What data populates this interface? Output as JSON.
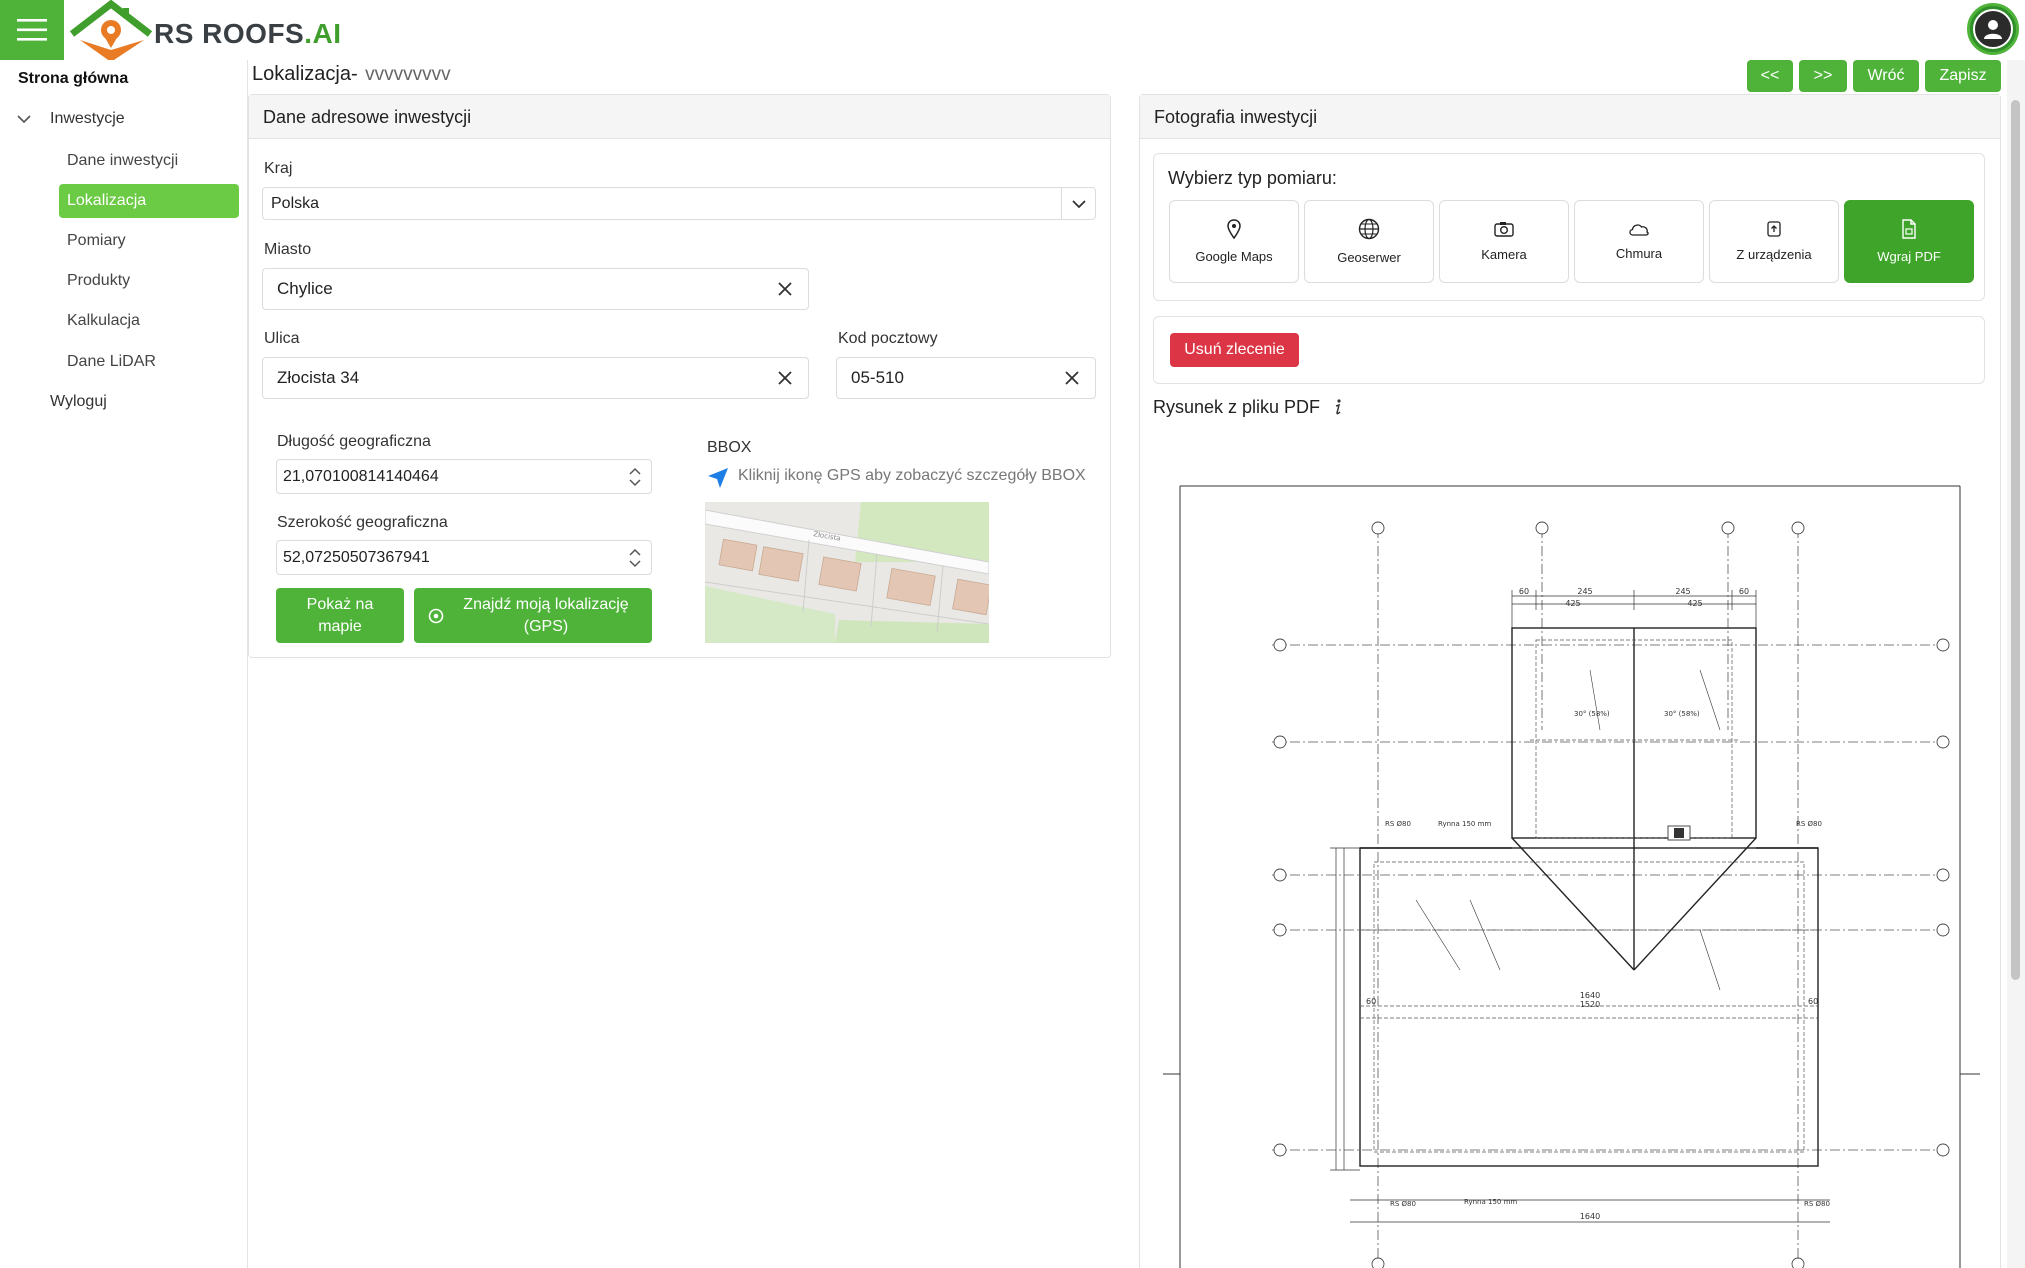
{
  "brand": {
    "name_main": "RS ROOFS",
    "name_suffix": ".AI",
    "accent": "#4fb33a",
    "danger": "#dc3545"
  },
  "sidebar": {
    "home": "Strona główna",
    "investments": "Inwestycje",
    "sub_items": [
      "Dane inwestycji",
      "Lokalizacja",
      "Pomiary",
      "Produkty",
      "Kalkulacja",
      "Dane LiDAR"
    ],
    "active_index": 1,
    "logout": "Wyloguj"
  },
  "header": {
    "title": "Lokalizacja-",
    "subtitle": "vvvvvvvvv",
    "buttons": {
      "prev": "<<",
      "next": ">>",
      "back": "Wróć",
      "save": "Zapisz"
    }
  },
  "address_card": {
    "title": "Dane adresowe inwestycji",
    "country_label": "Kraj",
    "country_value": "Polska",
    "city_label": "Miasto",
    "city_value": "Chylice",
    "street_label": "Ulica",
    "street_value": "Złocista 34",
    "postal_label": "Kod pocztowy",
    "postal_value": "05-510",
    "lon_label": "Długość geograficzna",
    "lon_value": "21,070100814140464",
    "lat_label": "Szerokość geograficzna",
    "lat_value": "52,07250507367941",
    "show_map": "Pokaż na mapie",
    "find_gps": "Znajdź moją lokalizację (GPS)",
    "bbox_label": "BBOX",
    "bbox_hint": "Kliknij ikonę GPS aby zobaczyć szczegóły BBOX",
    "map_street": "Złocista"
  },
  "photo_card": {
    "title": "Fotografia inwestycji",
    "measure_title": "Wybierz typ pomiaru:",
    "tiles": [
      {
        "label": "Google Maps",
        "icon": "map-pin-icon"
      },
      {
        "label": "Geoserwer",
        "icon": "globe-icon"
      },
      {
        "label": "Kamera",
        "icon": "camera-icon"
      },
      {
        "label": "Chmura",
        "icon": "cloud-icon"
      },
      {
        "label": "Z urządzenia",
        "icon": "device-icon"
      },
      {
        "label": "Wgraj PDF",
        "icon": "pdf-file-icon"
      }
    ],
    "active_tile": 5,
    "delete_order": "Usuń zlecenie",
    "pdf_label": "Rysunek z pliku PDF",
    "drawing_texts": {
      "dims_top": [
        "60",
        "245",
        "245",
        "60",
        "425",
        "425"
      ],
      "slope_a": "30° (58%)",
      "slope_b": "30° (58%)",
      "gutter": "Rynna 150 mm",
      "rs": "RS Ø80",
      "dim_1640": "1640",
      "dim_1520": "1520",
      "dim_60": "60"
    }
  }
}
